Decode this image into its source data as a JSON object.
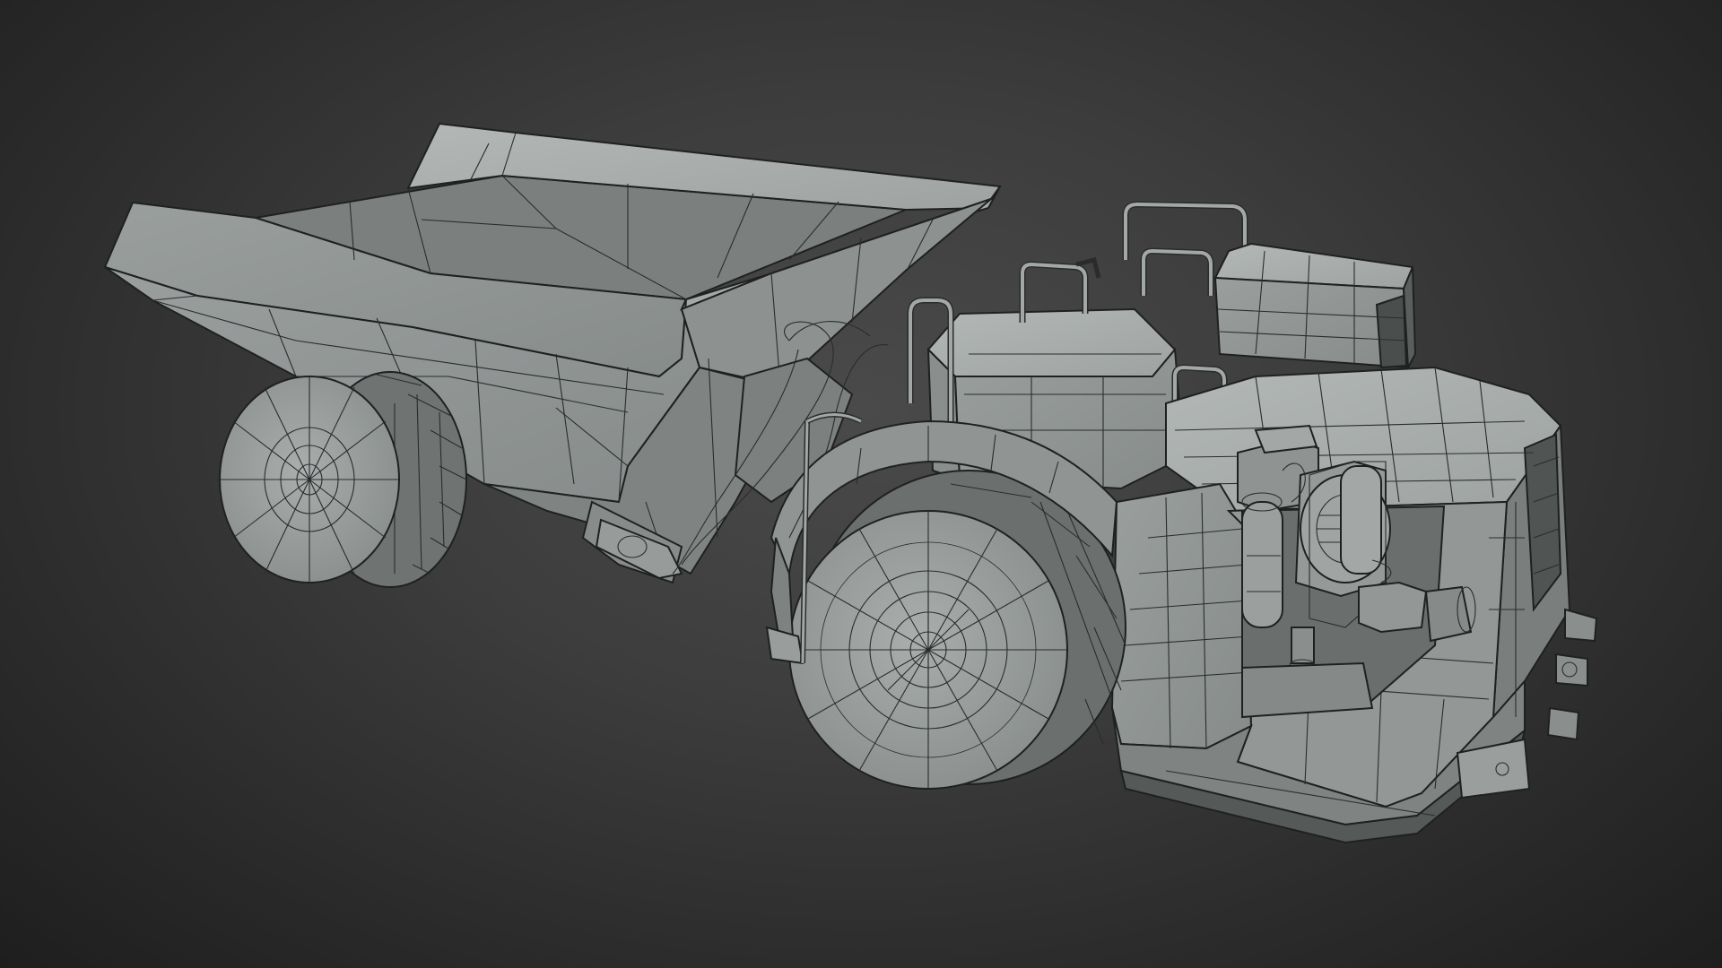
{
  "scene": {
    "subject": "articulated-mining-haul-truck-wireframe",
    "colors": {
      "background_center": "#4a4a4a",
      "background_edge": "#1e1e1e",
      "model_light": "#a7acab",
      "model_mid": "#8f9493",
      "model_dark": "#6d7271",
      "wire": "#2a2c2c"
    }
  }
}
